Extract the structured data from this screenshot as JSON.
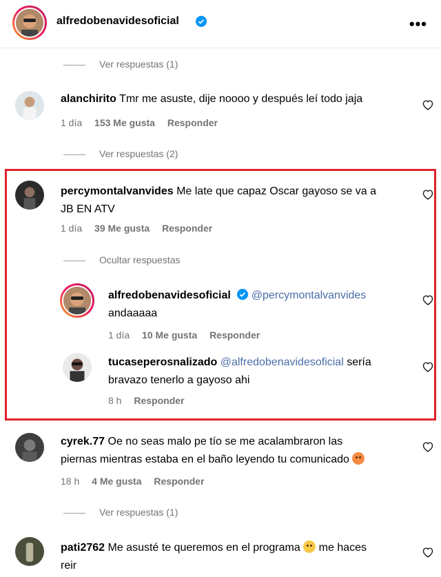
{
  "header": {
    "username": "alfredobenavidesoficial",
    "more": "•••"
  },
  "threads": [
    {
      "replies_toggle": "Ver respuestas (1)"
    },
    {
      "username": "alanchirito",
      "text": "Tmr me asuste, dije noooo y después leí todo jaja",
      "time": "1 día",
      "likes": "153 Me gusta",
      "reply": "Responder",
      "replies_toggle": "Ver respuestas (2)"
    },
    {
      "username": "percymontalvanvides",
      "text_line1": "Me late que capaz Oscar gayoso se va a",
      "text_line2": "JB EN ATV",
      "time": "1 día",
      "likes": "39 Me gusta",
      "reply": "Responder",
      "replies_toggle": "Ocultar respuestas",
      "replies": [
        {
          "username": "alfredobenavidesoficial",
          "mention": "@percymontalvanvides",
          "text": "andaaaaa",
          "time": "1 día",
          "likes": "10 Me gusta",
          "reply": "Responder"
        },
        {
          "username": "tucaseperosnalizado",
          "mention": "@alfredobenavidesoficial",
          "text_line1": "sería",
          "text_line2": "bravazo tenerlo a gayoso ahi",
          "time": "8 h",
          "reply": "Responder"
        }
      ]
    },
    {
      "username": "cyrek.77",
      "text_line1": "Oe no seas malo pe tío se me acalambraron las",
      "text_line2": "piernas mientras estaba en el baño leyendo tu comunicado",
      "emoji": "face-emoji",
      "time": "18 h",
      "likes": "4 Me gusta",
      "reply": "Responder",
      "replies_toggle": "Ver respuestas (1)"
    },
    {
      "username": "pati2762",
      "text_line1": "Me asusté te queremos en el programa",
      "text_after_emoji": "me haces",
      "text_line2": "reir",
      "emoji": "flushed-face-emoji"
    }
  ],
  "colors": {
    "highlight_border": "#e0222b",
    "verified": "#0095f6",
    "mention": "#4a6da7",
    "meta": "#737373"
  }
}
